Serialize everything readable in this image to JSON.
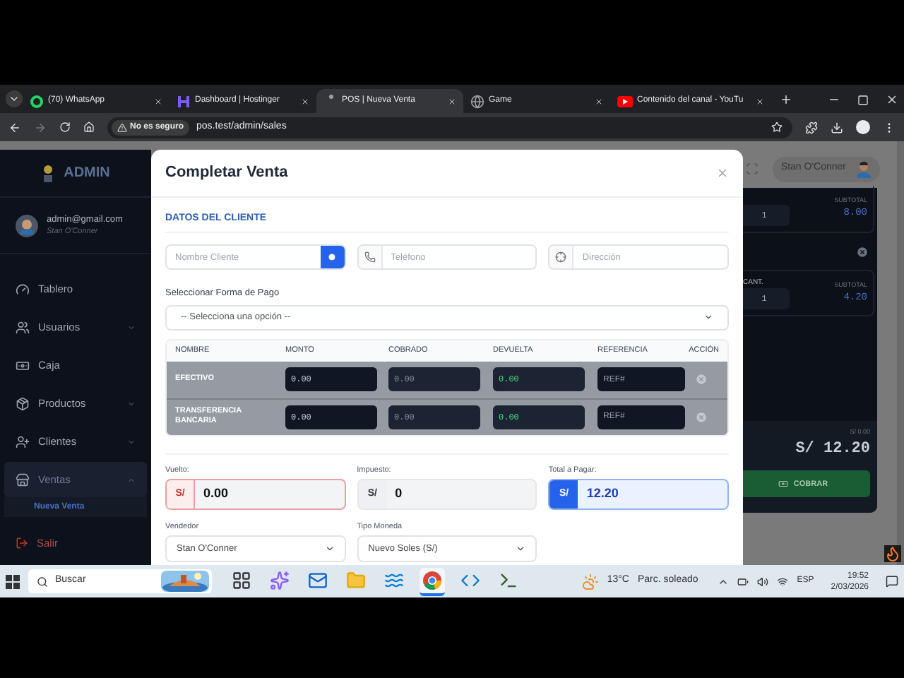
{
  "browser": {
    "tabs": [
      {
        "title": "(70) WhatsApp",
        "kind": "whatsapp",
        "selected": false
      },
      {
        "title": "Dashboard | Hostinger",
        "kind": "hostinger",
        "selected": false
      },
      {
        "title": "POS | Nueva Venta",
        "kind": "loading",
        "selected": true
      },
      {
        "title": "Game",
        "kind": "globe",
        "selected": false
      },
      {
        "title": "Contenido del canal - YouTu",
        "kind": "youtube",
        "selected": false
      }
    ],
    "security": "No es seguro",
    "url": "pos.test/admin/sales"
  },
  "sidebar": {
    "brand": "ADMIN",
    "email": "admin@gmail.com",
    "user": "Stan O'Conner",
    "items": [
      {
        "label": "Tablero",
        "kind": "gauge",
        "selected": false
      },
      {
        "label": "Usuarios",
        "kind": "users",
        "selected": false,
        "expanded": false
      },
      {
        "label": "Caja",
        "kind": "cash",
        "selected": false
      },
      {
        "label": "Productos",
        "kind": "box",
        "selected": false,
        "expanded": false
      },
      {
        "label": "Clientes",
        "kind": "clients",
        "selected": false,
        "expanded": false
      },
      {
        "label": "Ventas",
        "kind": "store",
        "selected": true,
        "expanded": true,
        "children": [
          {
            "label": "Nueva Venta",
            "selected": true
          }
        ]
      }
    ],
    "logout": "Salir"
  },
  "header": {
    "user": "Stan O'Conner"
  },
  "cart": {
    "items": [
      {
        "subtotal_label": "SUBTOTAL",
        "quantity": "1",
        "subtotal": "8.00"
      },
      {
        "quantity_label": "CANT.",
        "subtotal_label": "SUBTOTAL",
        "quantity": "1",
        "subtotal": "4.20"
      }
    ],
    "received": "S/ 0.00",
    "total": "S/ 12.20",
    "button": "COBRAR"
  },
  "modal": {
    "title": "Completar Venta",
    "section": "DATOS DEL CLIENTE",
    "client_fields": [
      {
        "placeholder": "Nombre Cliente",
        "kind": "search"
      },
      {
        "placeholder": "Teléfono",
        "kind": "phone"
      },
      {
        "placeholder": "Dirección",
        "kind": "location"
      }
    ],
    "payment_label": "Seleccionar Forma de Pago",
    "payment_select": "-- Selecciona una opción --",
    "columns": [
      "NOMBRE",
      "MONTO",
      "COBRADO",
      "DEVUELTA",
      "REFERENCIA",
      "ACCIÓN"
    ],
    "rows": [
      {
        "name": "EFECTIVO",
        "amount": "0.00",
        "collected": "0.00",
        "change": "0.00",
        "reference_placeholder": "REF#"
      },
      {
        "name": "TRANSFERENCIA BANCARIA",
        "amount": "0.00",
        "collected": "0.00",
        "change": "0.00",
        "reference_placeholder": "REF#"
      }
    ],
    "totals": [
      {
        "label": "Vuelto:",
        "currency": "S/",
        "value": "0.00",
        "kind": "change"
      },
      {
        "label": "Impuesto:",
        "currency": "S/",
        "value": "0",
        "kind": "tax"
      },
      {
        "label": "Total a Pagar:",
        "currency": "S/",
        "value": "12.20",
        "kind": "total"
      }
    ],
    "selects": [
      {
        "label": "Vendedor",
        "value": "Stan O'Conner"
      },
      {
        "label": "Tipo Moneda",
        "value": "Nuevo Soles (S/)"
      }
    ]
  },
  "taskbar": {
    "search": "Buscar",
    "temperature": "13°C",
    "weather": "Parc. soleado",
    "language": "ESP",
    "time": "19:52",
    "date": "2/03/2026",
    "apps": [
      {
        "kind": "taskview",
        "selected": false
      },
      {
        "kind": "copilot",
        "selected": false
      },
      {
        "kind": "outlook",
        "selected": false
      },
      {
        "kind": "files",
        "selected": false
      },
      {
        "kind": "edge",
        "selected": false
      },
      {
        "kind": "chrome",
        "selected": true
      },
      {
        "kind": "vscode",
        "selected": false
      },
      {
        "kind": "terminal",
        "selected": false
      }
    ]
  }
}
